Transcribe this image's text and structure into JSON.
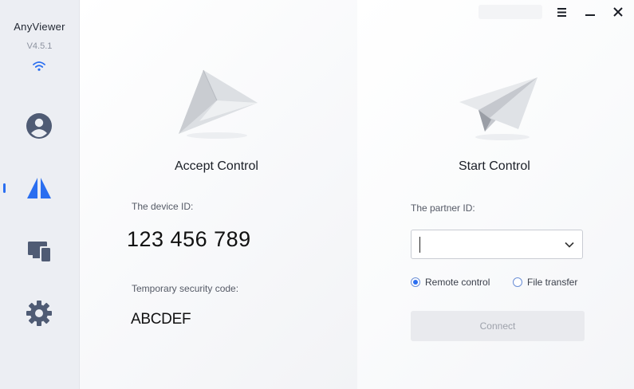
{
  "app": {
    "name": "AnyViewer",
    "version": "V4.5.1"
  },
  "sidebar": {
    "items": [
      {
        "name": "account",
        "icon": "user-icon"
      },
      {
        "name": "connect",
        "icon": "remote-control-icon",
        "active": true
      },
      {
        "name": "devices",
        "icon": "devices-icon"
      },
      {
        "name": "settings",
        "icon": "gear-icon"
      }
    ],
    "accent_color": "#2a6ef0",
    "icon_color": "#4f5b74"
  },
  "window_controls": {
    "menu_icon": "menu-icon",
    "minimize_icon": "minimize-icon",
    "close_icon": "close-icon"
  },
  "accept": {
    "title": "Accept Control",
    "device_id_label": "The device ID:",
    "device_id": "123 456 789",
    "security_label": "Temporary security code:",
    "security_code": "ABCDEF"
  },
  "start": {
    "title": "Start Control",
    "partner_label": "The partner ID:",
    "partner_value": "",
    "radio_remote": "Remote control",
    "radio_file": "File transfer",
    "selected_mode": "Remote control",
    "connect_label": "Connect"
  }
}
